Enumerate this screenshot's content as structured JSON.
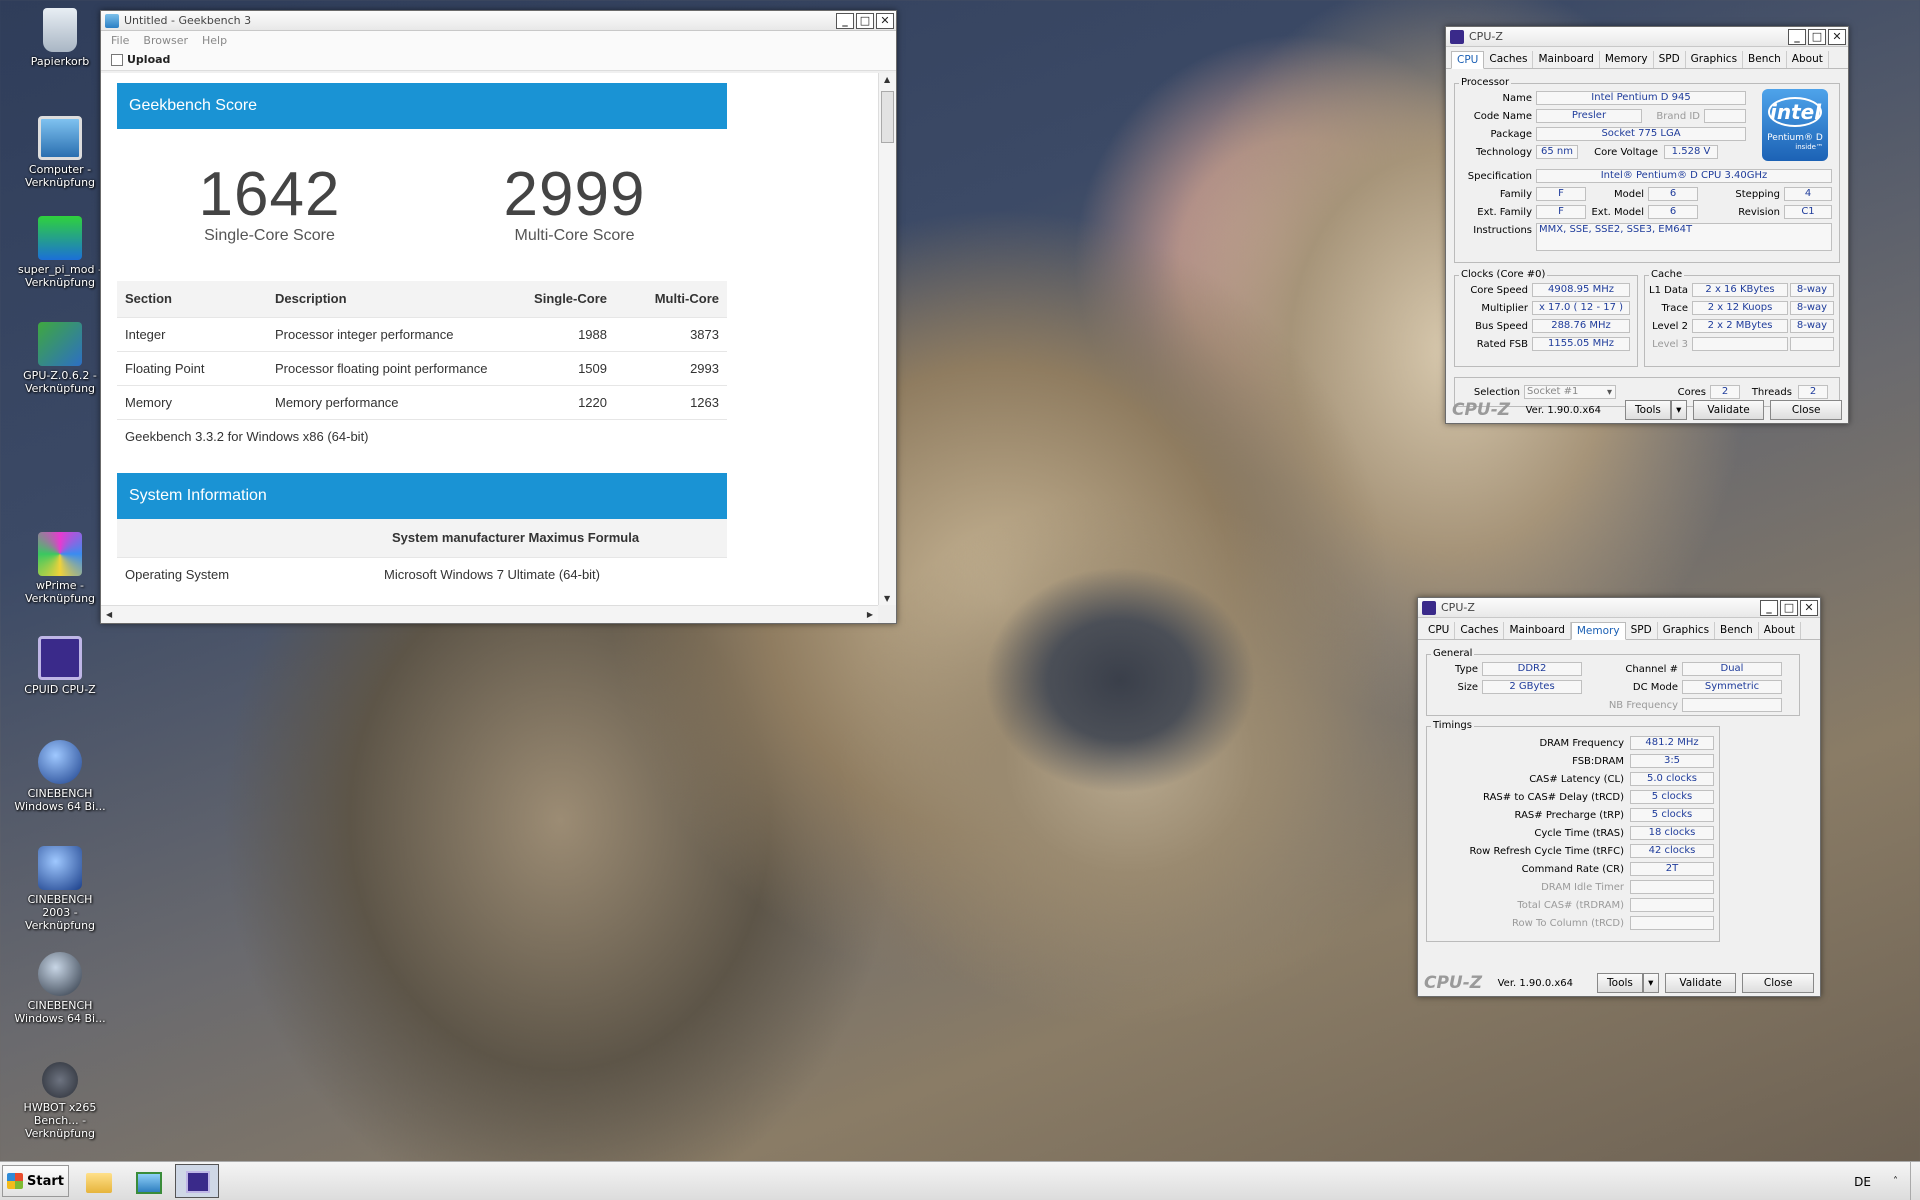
{
  "desktop": {
    "icons": [
      {
        "label": "Papierkorb"
      },
      {
        "label": "Computer - Verknüpfung"
      },
      {
        "label": "super_pi_mod - Verknüpfung"
      },
      {
        "label": "GPU-Z.0.6.2 - Verknüpfung"
      },
      {
        "label": "wPrime - Verknüpfung"
      },
      {
        "label": "CPUID CPU-Z"
      },
      {
        "label": "CINEBENCH Windows 64 Bi..."
      },
      {
        "label": "CINEBENCH 2003 - Verknüpfung"
      },
      {
        "label": "CINEBENCH Windows 64 Bi..."
      },
      {
        "label": "HWBOT x265 Bench... - Verknüpfung"
      }
    ]
  },
  "geekbench": {
    "title": "Untitled - Geekbench 3",
    "menu": [
      "File",
      "Browser",
      "Help"
    ],
    "toolbar_upload": "Upload",
    "score_header": "Geekbench Score",
    "single_score": "1642",
    "single_label": "Single-Core Score",
    "multi_score": "2999",
    "multi_label": "Multi-Core Score",
    "columns": {
      "section": "Section",
      "description": "Description",
      "single": "Single-Core",
      "multi": "Multi-Core"
    },
    "rows": [
      {
        "section": "Integer",
        "description": "Processor integer performance",
        "single": "1988",
        "multi": "3873"
      },
      {
        "section": "Floating Point",
        "description": "Processor floating point performance",
        "single": "1509",
        "multi": "2993"
      },
      {
        "section": "Memory",
        "description": "Memory performance",
        "single": "1220",
        "multi": "1263"
      }
    ],
    "version_line": "Geekbench 3.3.2 for Windows x86 (64-bit)",
    "sysinfo_header": "System Information",
    "sys_manufacturer": "System manufacturer Maximus Formula",
    "os_label": "Operating System",
    "os_value": "Microsoft Windows 7 Ultimate (64-bit)"
  },
  "cpuz_cpu": {
    "title": "CPU-Z",
    "tabs": [
      "CPU",
      "Caches",
      "Mainboard",
      "Memory",
      "SPD",
      "Graphics",
      "Bench",
      "About"
    ],
    "processor_group": "Processor",
    "name_label": "Name",
    "name": "Intel Pentium D 945",
    "codename_label": "Code Name",
    "codename": "Presler",
    "brandid_label": "Brand ID",
    "package_label": "Package",
    "package": "Socket 775 LGA",
    "technology_label": "Technology",
    "technology": "65 nm",
    "corevoltage_label": "Core Voltage",
    "corevoltage": "1.528 V",
    "spec_label": "Specification",
    "spec": "Intel® Pentium® D CPU 3.40GHz",
    "family_label": "Family",
    "family": "F",
    "model_label": "Model",
    "model": "6",
    "stepping_label": "Stepping",
    "stepping": "4",
    "extfamily_label": "Ext. Family",
    "extfamily": "F",
    "extmodel_label": "Ext. Model",
    "extmodel": "6",
    "revision_label": "Revision",
    "revision": "C1",
    "instructions_label": "Instructions",
    "instructions": "MMX, SSE, SSE2, SSE3, EM64T",
    "intel_logo": "intel",
    "intel_brand": "Pentium® D",
    "intel_inside": "inside™",
    "clocks_group": "Clocks (Core #0)",
    "corespeed_label": "Core Speed",
    "corespeed": "4908.95 MHz",
    "multiplier_label": "Multiplier",
    "multiplier": "x 17.0 ( 12 - 17 )",
    "busspeed_label": "Bus Speed",
    "busspeed": "288.76 MHz",
    "ratedfsb_label": "Rated FSB",
    "ratedfsb": "1155.05 MHz",
    "cache_group": "Cache",
    "l1_label": "L1 Data",
    "l1": "2 x 16 KBytes",
    "l1_way": "8-way",
    "trace_label": "Trace",
    "trace": "2 x 12 Kuops",
    "trace_way": "8-way",
    "l2_label": "Level 2",
    "l2": "2 x 2 MBytes",
    "l2_way": "8-way",
    "l3_label": "Level 3",
    "selection_label": "Selection",
    "selection": "Socket #1",
    "cores_label": "Cores",
    "cores": "2",
    "threads_label": "Threads",
    "threads": "2",
    "logo": "CPU-Z",
    "version": "Ver. 1.90.0.x64",
    "tools": "Tools",
    "validate": "Validate",
    "close": "Close"
  },
  "cpuz_mem": {
    "title": "CPU-Z",
    "tabs": [
      "CPU",
      "Caches",
      "Mainboard",
      "Memory",
      "SPD",
      "Graphics",
      "Bench",
      "About"
    ],
    "general_group": "General",
    "type_label": "Type",
    "type": "DDR2",
    "size_label": "Size",
    "size": "2 GBytes",
    "channel_label": "Channel #",
    "channel": "Dual",
    "dcmode_label": "DC Mode",
    "dcmode": "Symmetric",
    "nbfreq_label": "NB Frequency",
    "timings_group": "Timings",
    "timings": [
      {
        "label": "DRAM Frequency",
        "value": "481.2 MHz"
      },
      {
        "label": "FSB:DRAM",
        "value": "3:5"
      },
      {
        "label": "CAS# Latency (CL)",
        "value": "5.0 clocks"
      },
      {
        "label": "RAS# to CAS# Delay (tRCD)",
        "value": "5 clocks"
      },
      {
        "label": "RAS# Precharge (tRP)",
        "value": "5 clocks"
      },
      {
        "label": "Cycle Time (tRAS)",
        "value": "18 clocks"
      },
      {
        "label": "Row Refresh Cycle Time (tRFC)",
        "value": "42 clocks"
      },
      {
        "label": "Command Rate (CR)",
        "value": "2T"
      },
      {
        "label": "DRAM Idle Timer",
        "value": ""
      },
      {
        "label": "Total CAS# (tRDRAM)",
        "value": ""
      },
      {
        "label": "Row To Column (tRCD)",
        "value": ""
      }
    ],
    "logo": "CPU-Z",
    "version": "Ver. 1.90.0.x64",
    "tools": "Tools",
    "validate": "Validate",
    "close": "Close"
  },
  "taskbar": {
    "start": "Start",
    "language": "DE"
  }
}
